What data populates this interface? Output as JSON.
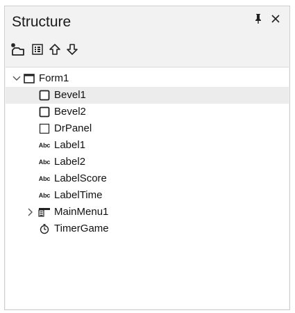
{
  "panel": {
    "title": "Structure",
    "pin_icon": "pin-icon",
    "close_icon": "close-icon"
  },
  "toolbar": {
    "buttons": [
      {
        "name": "new-tab-order-button",
        "icon": "new-item-icon"
      },
      {
        "name": "view-toggle-button",
        "icon": "grid-list-icon"
      },
      {
        "name": "move-up-button",
        "icon": "arrow-up-icon"
      },
      {
        "name": "move-down-button",
        "icon": "arrow-down-icon"
      }
    ]
  },
  "tree": {
    "nodes": [
      {
        "label": "Form1",
        "icon": "form-icon",
        "depth": 0,
        "expander": "expanded",
        "selected": false
      },
      {
        "label": "Bevel1",
        "icon": "bevel-icon",
        "depth": 1,
        "expander": "none",
        "selected": true
      },
      {
        "label": "Bevel2",
        "icon": "bevel-icon",
        "depth": 1,
        "expander": "none",
        "selected": false
      },
      {
        "label": "DrPanel",
        "icon": "panel-icon",
        "depth": 1,
        "expander": "none",
        "selected": false
      },
      {
        "label": "Label1",
        "icon": "label-icon",
        "icon_text": "Abc",
        "depth": 1,
        "expander": "none",
        "selected": false
      },
      {
        "label": "Label2",
        "icon": "label-icon",
        "icon_text": "Abc",
        "depth": 1,
        "expander": "none",
        "selected": false
      },
      {
        "label": "LabelScore",
        "icon": "label-icon",
        "icon_text": "Abc",
        "depth": 1,
        "expander": "none",
        "selected": false
      },
      {
        "label": "LabelTime",
        "icon": "label-icon",
        "icon_text": "Abc",
        "depth": 1,
        "expander": "none",
        "selected": false
      },
      {
        "label": "MainMenu1",
        "icon": "main-menu-icon",
        "depth": 1,
        "expander": "collapsed",
        "selected": false
      },
      {
        "label": "TimerGame",
        "icon": "timer-icon",
        "depth": 1,
        "expander": "none",
        "selected": false
      }
    ]
  },
  "colors": {
    "panel_bg": "#f2f2f2",
    "tree_bg": "#ffffff",
    "selected_row": "#ececec",
    "text": "#111111"
  }
}
